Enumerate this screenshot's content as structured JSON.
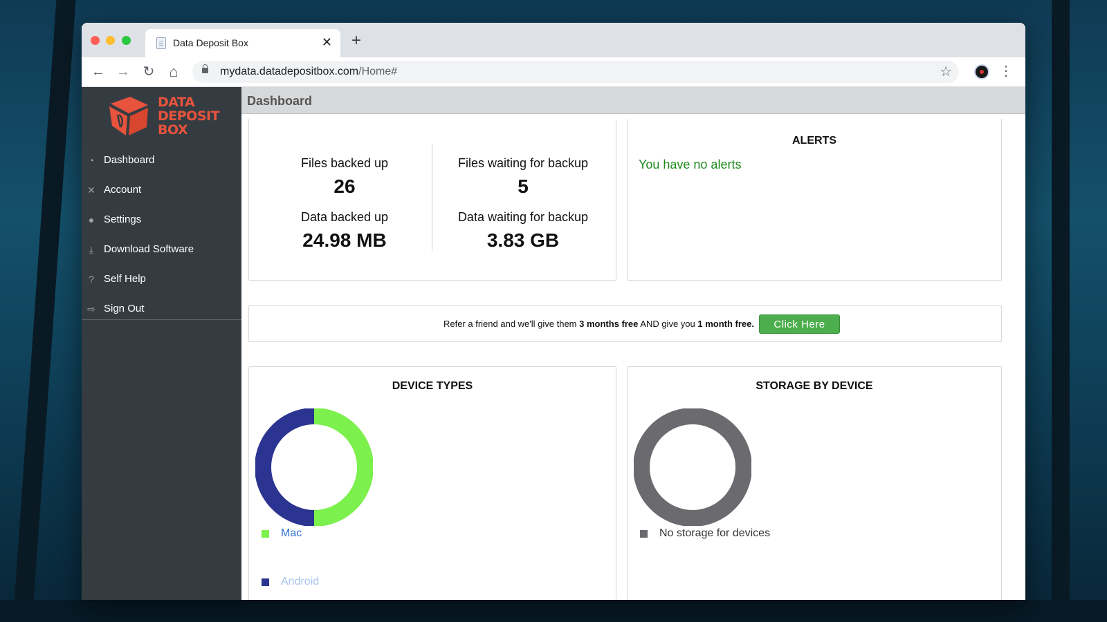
{
  "browser": {
    "tab_title": "Data Deposit Box",
    "tab_close": "✕",
    "new_tab": "+",
    "url_host": "mydata.datadepositbox.com",
    "url_path": "/Home#",
    "back": "←",
    "forward": "→",
    "reload": "↻",
    "home": "⌂",
    "star": "☆",
    "menu": "⋮"
  },
  "sidebar": {
    "logo": {
      "line1": "DATA",
      "line2": "DEPOSIT",
      "line3": "BOX",
      "color": "#e8533d"
    },
    "items": [
      {
        "label": "Dashboard",
        "icon": "dashboard-icon"
      },
      {
        "label": "Account",
        "icon": "tools-icon"
      },
      {
        "label": "Settings",
        "icon": "user-icon"
      },
      {
        "label": "Download Software",
        "icon": "download-icon"
      },
      {
        "label": "Self Help",
        "icon": "help-icon"
      },
      {
        "label": "Sign Out",
        "icon": "sign-out-icon"
      }
    ]
  },
  "header": {
    "title": "Dashboard"
  },
  "stats": {
    "files_backed_label": "Files backed up",
    "files_backed_value": "26",
    "data_backed_label": "Data backed up",
    "data_backed_value": "24.98 MB",
    "files_waiting_label": "Files waiting for backup",
    "files_waiting_value": "5",
    "data_waiting_label": "Data waiting for backup",
    "data_waiting_value": "3.83 GB"
  },
  "alerts": {
    "title": "ALERTS",
    "message": "You have no alerts",
    "message_color": "#1e8a1e"
  },
  "referral": {
    "text_1": "Refer a friend and we'll give them ",
    "bold_1": "3 months free",
    "text_2": " AND give you ",
    "bold_2": "1 month free.",
    "button": "Click Here",
    "button_color": "#4cae4c"
  },
  "device_types": {
    "title": "DEVICE TYPES",
    "legend": [
      {
        "label": "Mac",
        "color": "#7cf04c",
        "text_color": "#2f6fd0"
      },
      {
        "label": "Android",
        "color": "#2b3490",
        "text_color": "#a9c2ef"
      }
    ]
  },
  "storage_by_device": {
    "title": "STORAGE BY DEVICE",
    "legend": [
      {
        "label": "No storage for devices",
        "color": "#6b6b6f"
      }
    ]
  },
  "chart_data": [
    {
      "type": "pie",
      "title": "DEVICE TYPES",
      "categories": [
        "Mac",
        "Android"
      ],
      "values": [
        50,
        50
      ],
      "colors": [
        "#7cf04c",
        "#2b3490"
      ],
      "style": "donut"
    },
    {
      "type": "pie",
      "title": "STORAGE BY DEVICE",
      "categories": [
        "No storage for devices"
      ],
      "values": [
        100
      ],
      "colors": [
        "#6b6b6f"
      ],
      "style": "donut"
    }
  ]
}
